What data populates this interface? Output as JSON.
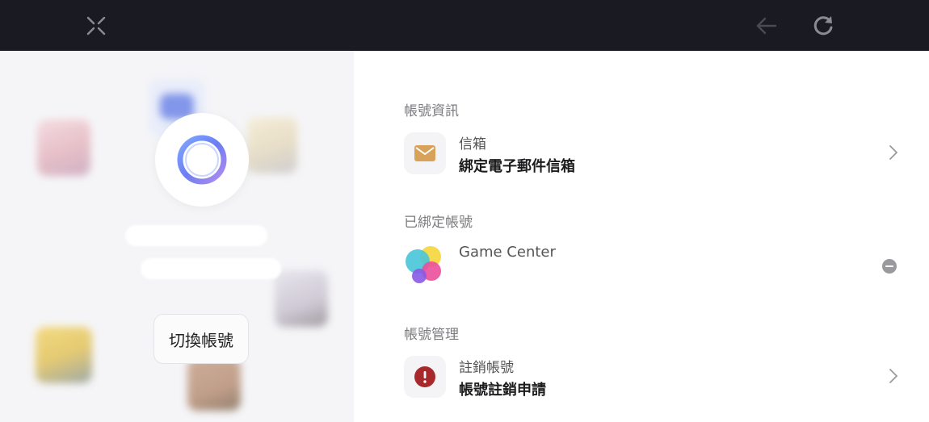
{
  "topbar": {
    "close_icon": "close-x-icon",
    "back_icon": "arrow-left-icon",
    "refresh_icon": "refresh-icon",
    "background": "#1a1b22"
  },
  "left": {
    "switch_account_label": "切換帳號"
  },
  "sections": {
    "account_info": {
      "title": "帳號資訊",
      "mail": {
        "label": "信箱",
        "value": "綁定電子郵件信箱",
        "icon": "envelope-icon",
        "icon_color": "#d9a25a"
      }
    },
    "linked_accounts": {
      "title": "已綁定帳號",
      "game_center": {
        "label": "Game Center",
        "icon": "game-center-icon"
      }
    },
    "account_management": {
      "title": "帳號管理",
      "delete": {
        "label": "註銷帳號",
        "value": "帳號註銷申請",
        "icon": "warning-icon",
        "icon_color": "#a8292b"
      }
    }
  }
}
